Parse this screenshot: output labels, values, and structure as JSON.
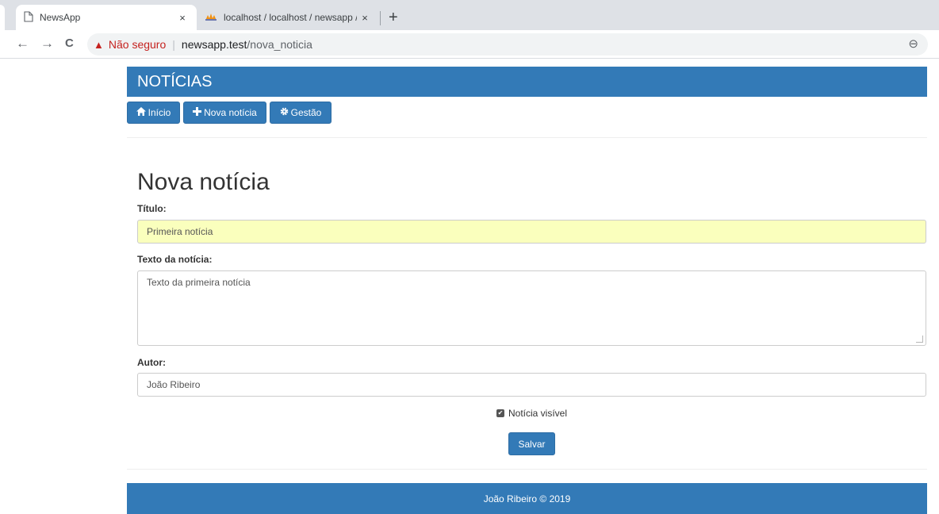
{
  "browser": {
    "tabs": [
      {
        "title": "NewsApp",
        "close": "×",
        "icon": "page-icon"
      },
      {
        "title": "localhost / localhost / newsapp /",
        "close": "×",
        "icon": "phpmyadmin-icon"
      }
    ],
    "new_tab": "+",
    "back": "←",
    "forward": "→",
    "reload": "C",
    "security_warning": "Não seguro",
    "url_host": "newsapp.test",
    "url_path": "/nova_noticia",
    "zoom_icon": "⊖"
  },
  "site": {
    "title": "NOTÍCIAS",
    "nav": [
      {
        "label": "Início",
        "icon": "home-icon"
      },
      {
        "label": "Nova notícia",
        "icon": "plus-icon"
      },
      {
        "label": "Gestão",
        "icon": "gear-icon"
      }
    ],
    "accent_color": "#337ab7"
  },
  "form": {
    "heading": "Nova notícia",
    "title_label": "Título:",
    "title_value": "Primeira notícia",
    "text_label": "Texto da notícia:",
    "text_value": "Texto da primeira notícia",
    "author_label": "Autor:",
    "author_value": "João Ribeiro",
    "visible_label": "Notícia visível",
    "visible_checked": true,
    "save_label": "Salvar"
  },
  "footer": {
    "text": "João Ribeiro © 2019"
  }
}
